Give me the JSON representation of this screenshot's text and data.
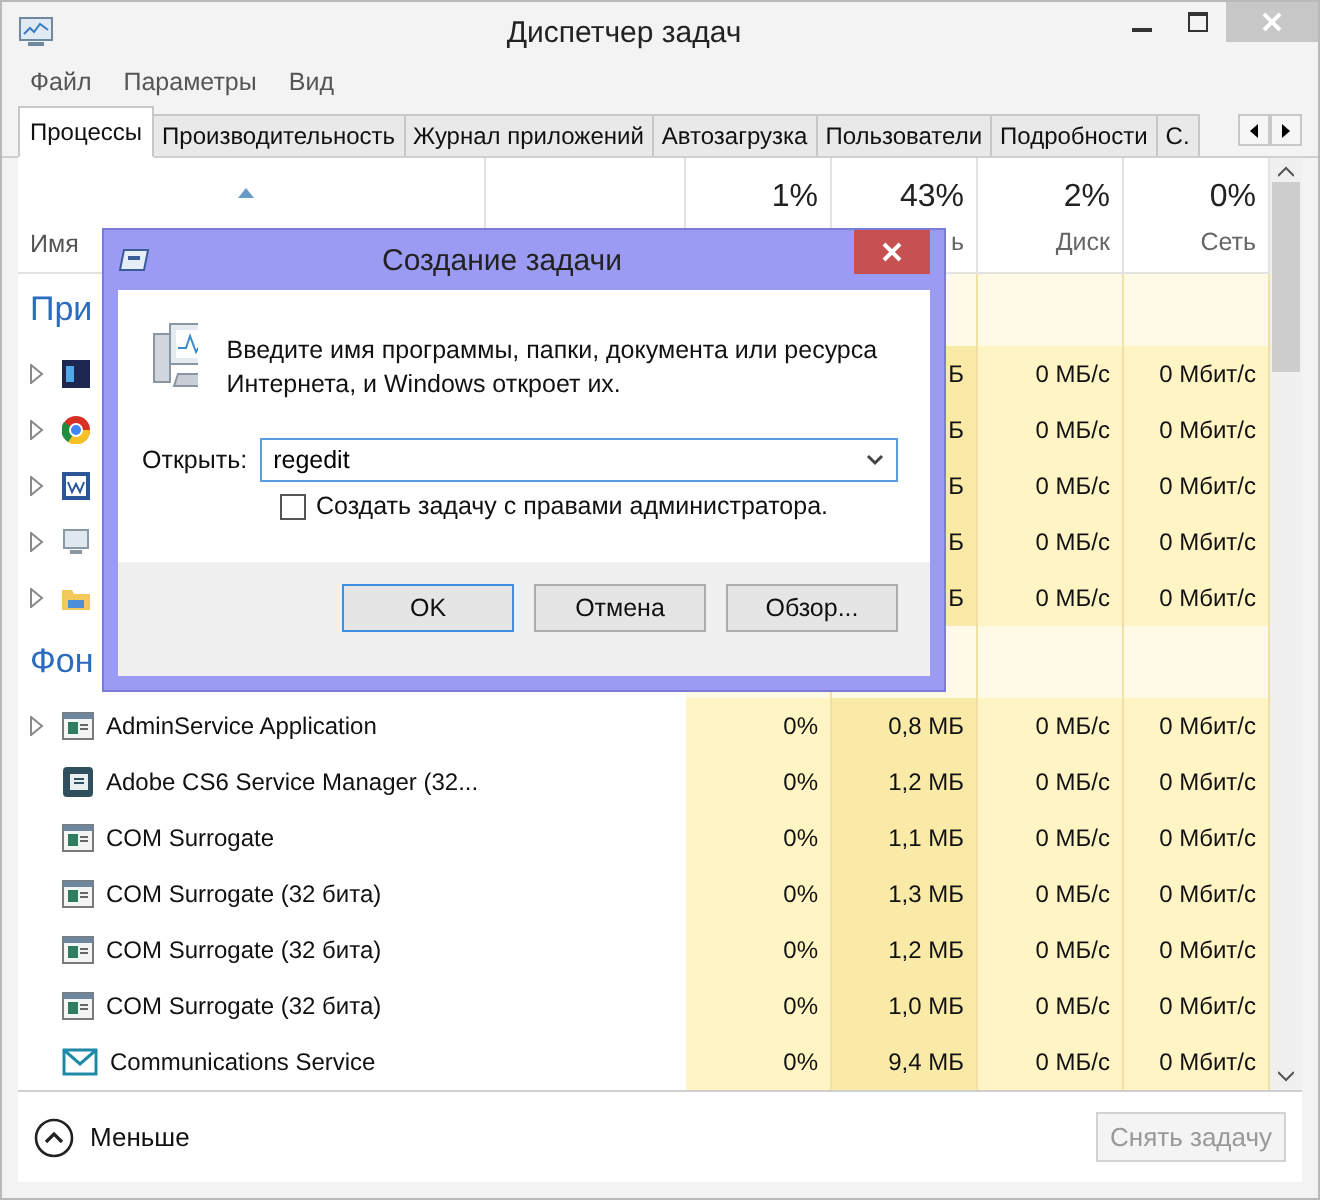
{
  "window": {
    "title": "Диспетчер задач"
  },
  "menu": [
    "Файл",
    "Параметры",
    "Вид"
  ],
  "tabs": [
    {
      "label": "Процессы",
      "selected": true
    },
    {
      "label": "Производительность",
      "selected": false
    },
    {
      "label": "Журнал приложений",
      "selected": false
    },
    {
      "label": "Автозагрузка",
      "selected": false
    },
    {
      "label": "Пользователи",
      "selected": false
    },
    {
      "label": "Подробности",
      "selected": false
    },
    {
      "label": "С.",
      "selected": false
    }
  ],
  "columns": {
    "name": {
      "label": "Имя"
    },
    "cpu": {
      "percent": "1%"
    },
    "memory": {
      "percent": "43%",
      "label": "ь"
    },
    "disk": {
      "percent": "2%",
      "label": "Диск"
    },
    "network": {
      "percent": "0%",
      "label": "Сеть"
    }
  },
  "groups": [
    {
      "title": "При",
      "rows": [
        {
          "expandable": true,
          "kind": "ps",
          "memory": "Б",
          "disk": "0 МБ/с",
          "network": "0 Мбит/с"
        },
        {
          "expandable": true,
          "kind": "chrome",
          "memory": "Б",
          "disk": "0 МБ/с",
          "network": "0 Мбит/с"
        },
        {
          "expandable": true,
          "kind": "word",
          "memory": "Б",
          "disk": "0 МБ/с",
          "network": "0 Мбит/с"
        },
        {
          "expandable": true,
          "kind": "monitor",
          "memory": "Б",
          "disk": "0 МБ/с",
          "network": "0 Мбит/с"
        },
        {
          "expandable": true,
          "kind": "folder",
          "memory": "Б",
          "disk": "0 МБ/с",
          "network": "0 Мбит/с"
        }
      ]
    },
    {
      "title": "Фон",
      "rows": [
        {
          "expandable": true,
          "kind": "service",
          "name": "AdminService Application",
          "cpu": "0%",
          "memory": "0,8 МБ",
          "disk": "0 МБ/с",
          "network": "0 Мбит/с"
        },
        {
          "expandable": false,
          "kind": "adobe",
          "name": "Adobe CS6 Service Manager (32...",
          "cpu": "0%",
          "memory": "1,2 МБ",
          "disk": "0 МБ/с",
          "network": "0 Мбит/с"
        },
        {
          "expandable": false,
          "kind": "service",
          "name": "COM Surrogate",
          "cpu": "0%",
          "memory": "1,1 МБ",
          "disk": "0 МБ/с",
          "network": "0 Мбит/с"
        },
        {
          "expandable": false,
          "kind": "service",
          "name": "COM Surrogate (32 бита)",
          "cpu": "0%",
          "memory": "1,3 МБ",
          "disk": "0 МБ/с",
          "network": "0 Мбит/с"
        },
        {
          "expandable": false,
          "kind": "service",
          "name": "COM Surrogate (32 бита)",
          "cpu": "0%",
          "memory": "1,2 МБ",
          "disk": "0 МБ/с",
          "network": "0 Мбит/с"
        },
        {
          "expandable": false,
          "kind": "service",
          "name": "COM Surrogate (32 бита)",
          "cpu": "0%",
          "memory": "1,0 МБ",
          "disk": "0 МБ/с",
          "network": "0 Мбит/с"
        },
        {
          "expandable": false,
          "kind": "mail",
          "name": "Communications Service",
          "cpu": "0%",
          "memory": "9,4 МБ",
          "disk": "0 МБ/с",
          "network": "0 Мбит/с"
        }
      ]
    }
  ],
  "footer": {
    "toggle": "Меньше",
    "end_task": {
      "label": "Снять задачу",
      "disabled": true
    }
  },
  "dialog": {
    "title": "Создание задачи",
    "message": "Введите имя программы, папки, документа или ресурса Интернета, и Windows откроет их.",
    "open_label": "Открыть:",
    "value": "regedit",
    "checkbox": {
      "label": "Создать задачу с правами администратора.",
      "checked": false
    },
    "buttons": [
      {
        "label": "OK",
        "default": true
      },
      {
        "label": "Отмена",
        "default": false
      },
      {
        "label": "Обзор...",
        "default": false
      }
    ]
  }
}
